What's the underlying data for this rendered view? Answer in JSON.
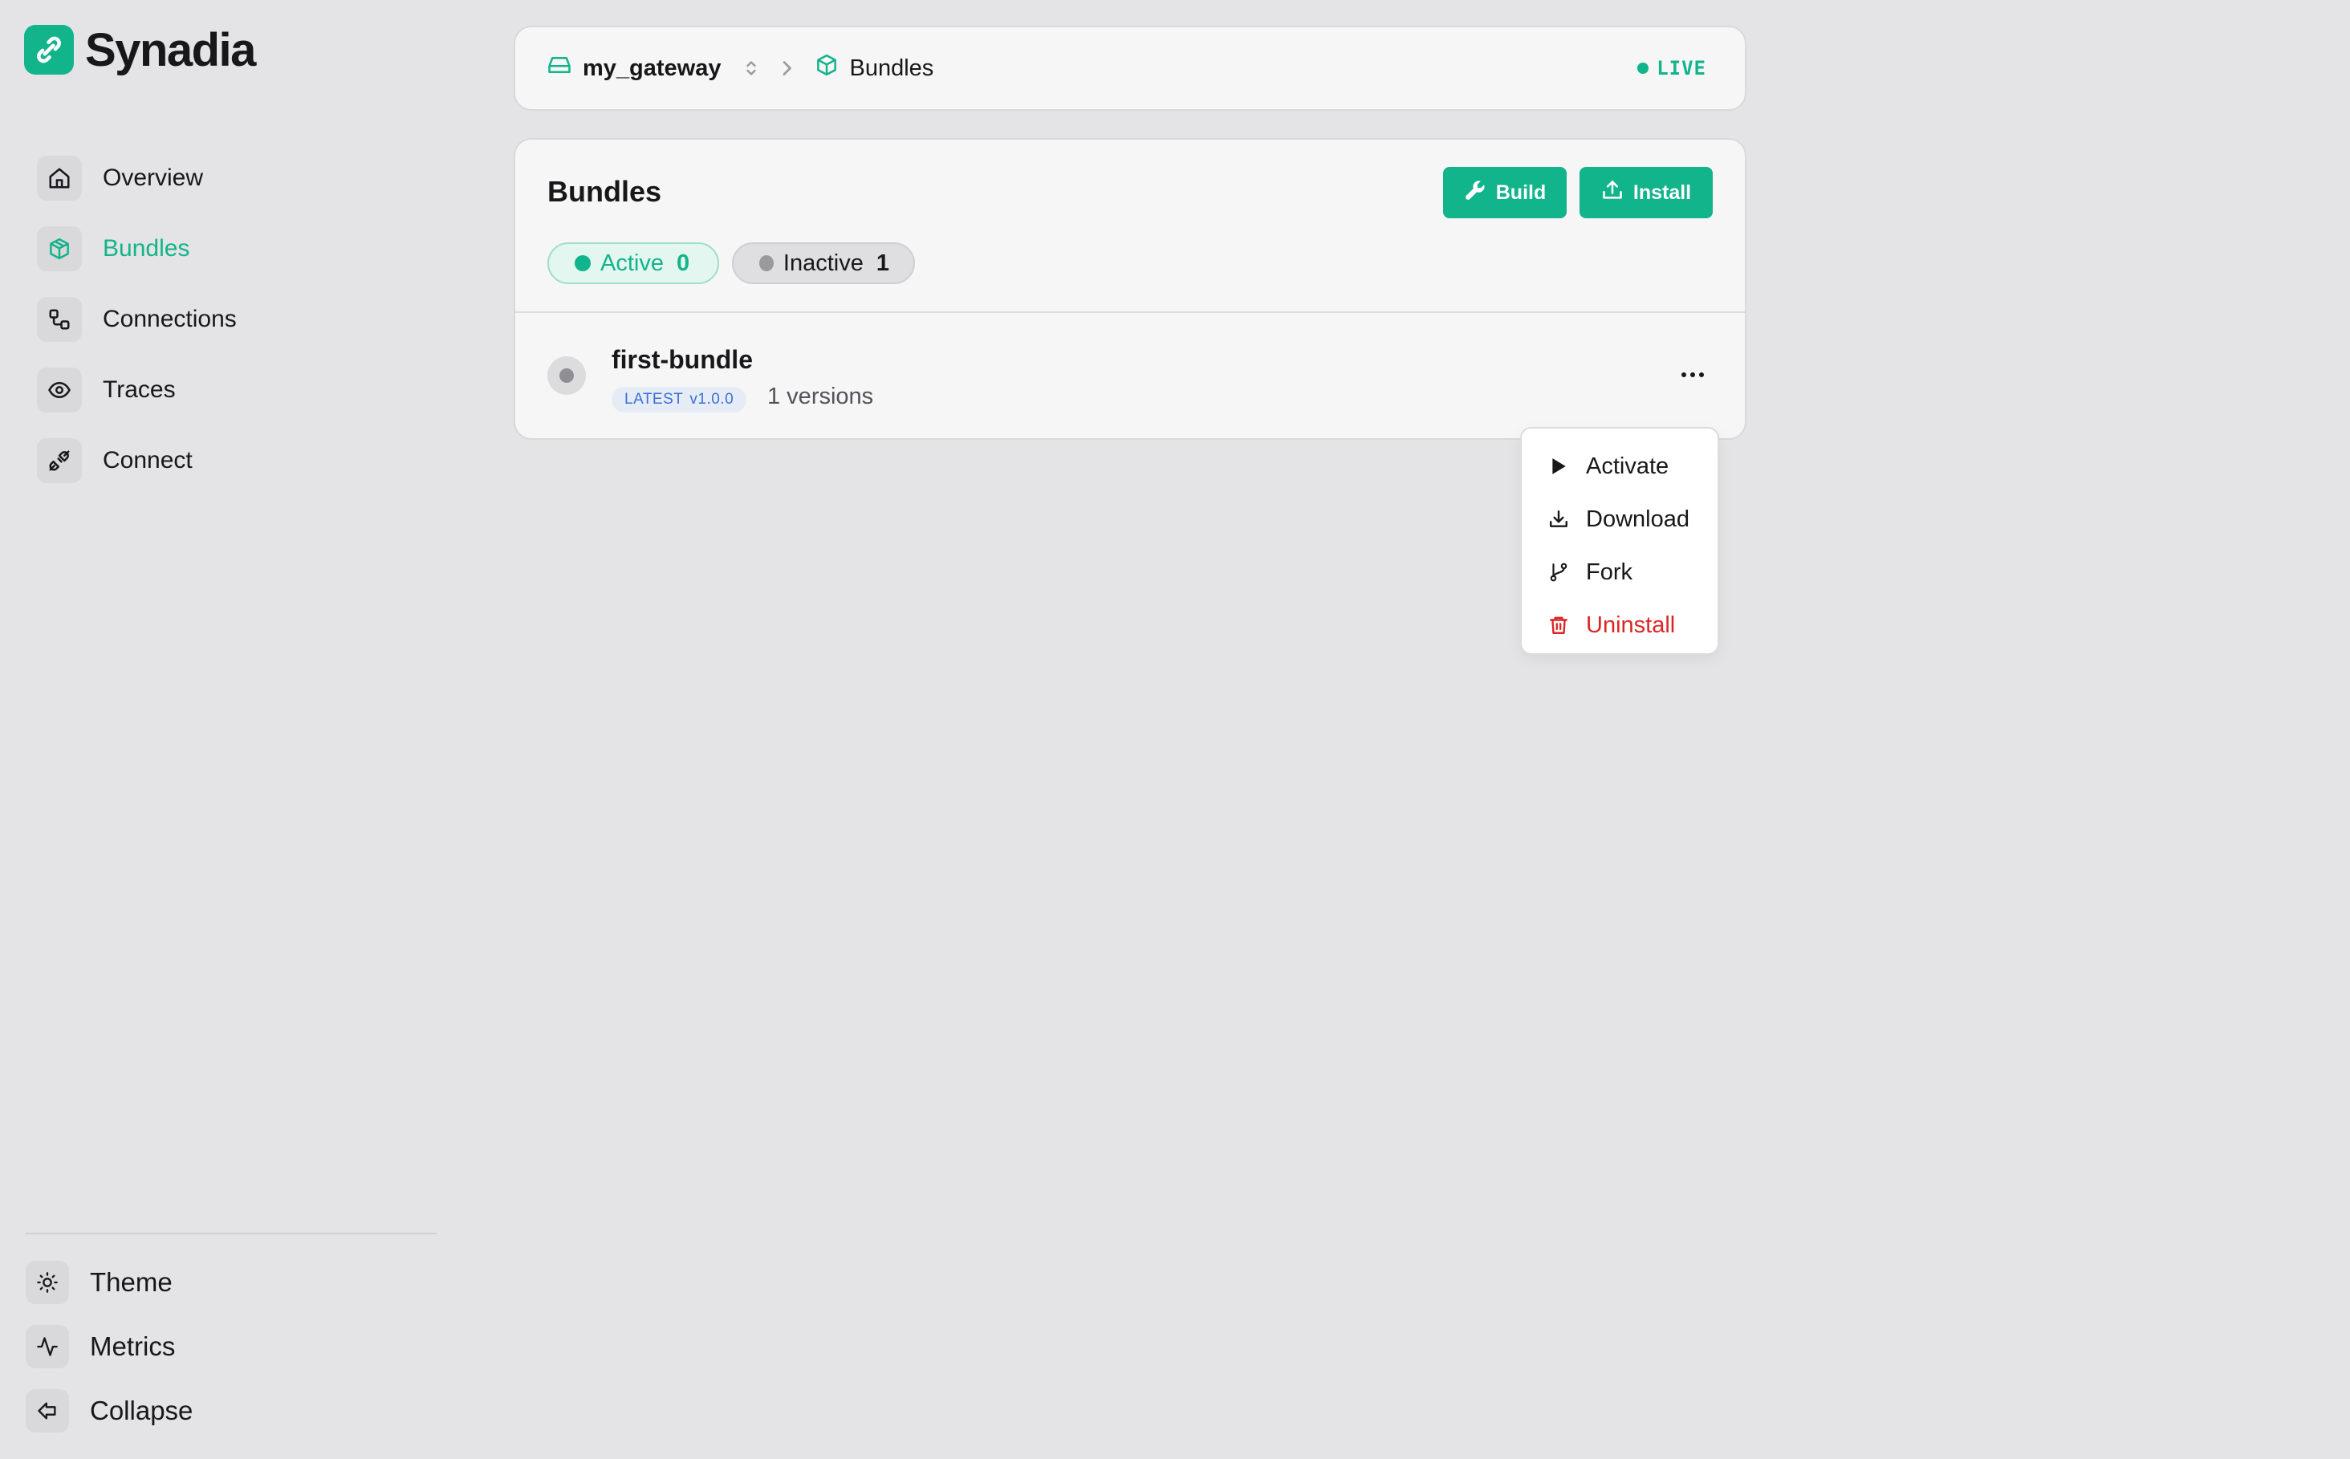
{
  "brand": {
    "name": "Synadia",
    "logo_icon": "synadia-logo-icon",
    "color": "#12b48c"
  },
  "sidebar": {
    "items": [
      {
        "label": "Overview",
        "icon": "home-icon",
        "active": false
      },
      {
        "label": "Bundles",
        "icon": "cube-icon",
        "active": true
      },
      {
        "label": "Connections",
        "icon": "connections-icon",
        "active": false
      },
      {
        "label": "Traces",
        "icon": "eye-icon",
        "active": false
      },
      {
        "label": "Connect",
        "icon": "plug-icon",
        "active": false
      }
    ],
    "bottom": [
      {
        "label": "Theme",
        "icon": "sun-icon"
      },
      {
        "label": "Metrics",
        "icon": "activity-icon"
      },
      {
        "label": "Collapse",
        "icon": "collapse-arrow-icon"
      }
    ]
  },
  "header": {
    "gateway": "my_gateway",
    "page": "Bundles",
    "status": "LIVE"
  },
  "bundles": {
    "title": "Bundles",
    "build_label": "Build",
    "install_label": "Install",
    "filters": {
      "active_label": "Active",
      "active_count": "0",
      "inactive_label": "Inactive",
      "inactive_count": "1"
    },
    "rows": [
      {
        "name": "first-bundle",
        "badge_tag": "LATEST",
        "badge_version": "v1.0.0",
        "versions": "1 versions",
        "status": "inactive"
      }
    ]
  },
  "menu": {
    "items": [
      {
        "label": "Activate",
        "icon": "play-icon"
      },
      {
        "label": "Download",
        "icon": "download-icon"
      },
      {
        "label": "Fork",
        "icon": "fork-icon"
      },
      {
        "label": "Uninstall",
        "icon": "trash-icon",
        "danger": true
      }
    ]
  },
  "colors": {
    "accent": "#12b48c",
    "danger": "#dc2626",
    "badge_text": "#3a6fd8"
  }
}
